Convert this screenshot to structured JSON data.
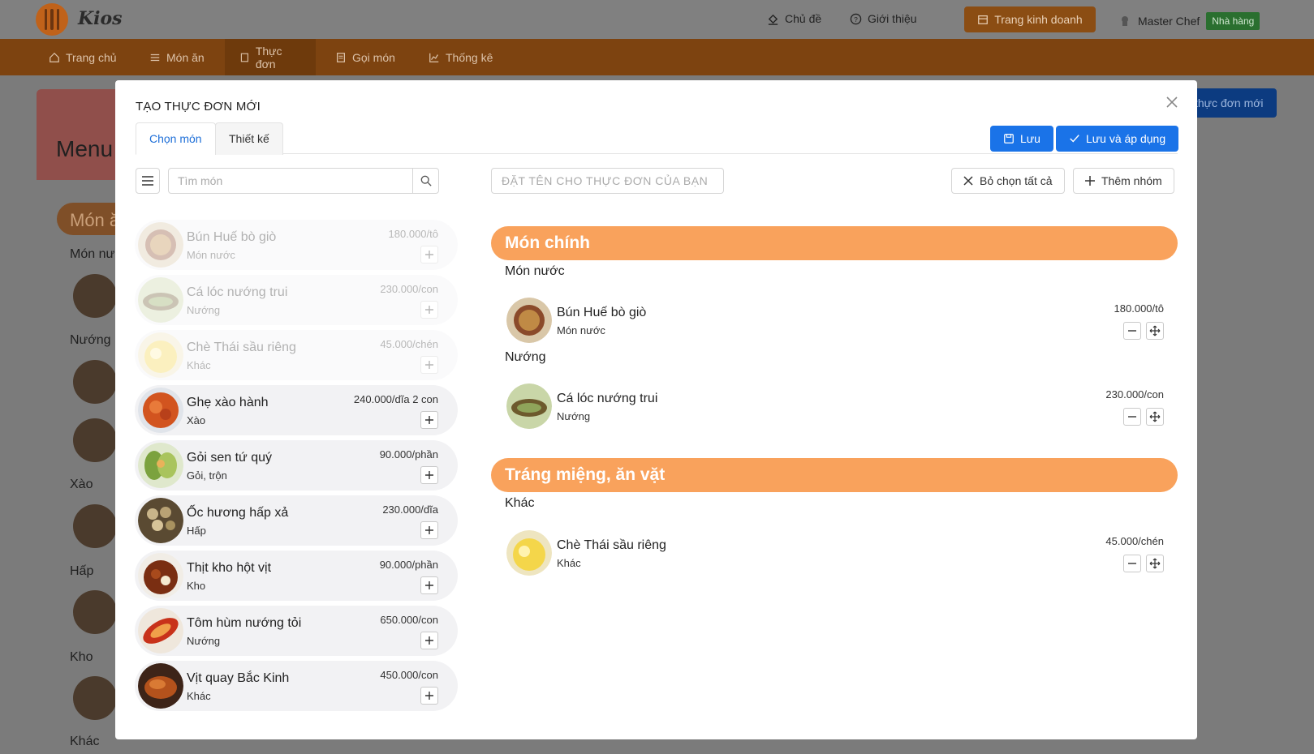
{
  "app": {
    "brand": "Kios"
  },
  "topbar": {
    "theme_label": "Chủ đề",
    "about_label": "Giới thiệu",
    "business_label": "Trang kinh doanh",
    "user_name": "Master Chef",
    "user_badge": "Nhà hàng"
  },
  "nav": {
    "items": [
      {
        "label": "Trang chủ"
      },
      {
        "label": "Món ăn"
      },
      {
        "label": "Thực đơn"
      },
      {
        "label": "Gọi món"
      },
      {
        "label": "Thống kê"
      }
    ],
    "active": "Thực đơn"
  },
  "background": {
    "title": "Menu",
    "pill": "Món ă",
    "labels": [
      "Món nư",
      "Nướng",
      "Xào",
      "Hấp",
      "Kho",
      "Khác"
    ],
    "new_button": "thực đơn mới"
  },
  "modal": {
    "title": "TẠO THỰC ĐƠN MỚI",
    "tabs": [
      {
        "label": "Chọn món"
      },
      {
        "label": "Thiết kế"
      }
    ],
    "save_label": "Lưu",
    "save_apply_label": "Lưu và áp dụng",
    "search_placeholder": "Tìm món",
    "menu_name_placeholder": "ĐẶT TÊN CHO THỰC ĐƠN CỦA BẠN",
    "deselect_all_label": "Bỏ chọn tất cả",
    "add_group_label": "Thêm nhóm"
  },
  "dishes": [
    {
      "name": "Bún Huế bò giò",
      "category": "Món nước",
      "price": "180.000/tô",
      "selected": true
    },
    {
      "name": "Cá lóc nướng trui",
      "category": "Nướng",
      "price": "230.000/con",
      "selected": true
    },
    {
      "name": "Chè Thái sầu riêng",
      "category": "Khác",
      "price": "45.000/chén",
      "selected": true
    },
    {
      "name": "Ghẹ xào hành",
      "category": "Xào",
      "price": "240.000/dĩa 2 con",
      "selected": false
    },
    {
      "name": "Gỏi sen tứ quý",
      "category": "Gỏi, trộn",
      "price": "90.000/phần",
      "selected": false
    },
    {
      "name": "Ốc hương hấp xả",
      "category": "Hấp",
      "price": "230.000/dĩa",
      "selected": false
    },
    {
      "name": "Thịt kho hột vịt",
      "category": "Kho",
      "price": "90.000/phần",
      "selected": false
    },
    {
      "name": "Tôm hùm nướng tỏi",
      "category": "Nướng",
      "price": "650.000/con",
      "selected": false
    },
    {
      "name": "Vịt quay Bắc Kinh",
      "category": "Khác",
      "price": "450.000/con",
      "selected": false
    }
  ],
  "menu_sections": [
    {
      "title": "Món chính",
      "groups": [
        {
          "name": "Món nước",
          "items": [
            {
              "name": "Bún Huế bò giò",
              "category": "Món nước",
              "price": "180.000/tô"
            }
          ]
        },
        {
          "name": "Nướng",
          "items": [
            {
              "name": "Cá lóc nướng trui",
              "category": "Nướng",
              "price": "230.000/con"
            }
          ]
        }
      ]
    },
    {
      "title": "Tráng miệng, ăn vặt",
      "groups": [
        {
          "name": "Khác",
          "items": [
            {
              "name": "Chè Thái sầu riêng",
              "category": "Khác",
              "price": "45.000/chén"
            }
          ]
        }
      ]
    }
  ],
  "colors": {
    "accent_orange": "#f9a25c",
    "nav_orange": "#e0791e",
    "primary_blue": "#1a73e8",
    "badge_green": "#3a9c41"
  }
}
